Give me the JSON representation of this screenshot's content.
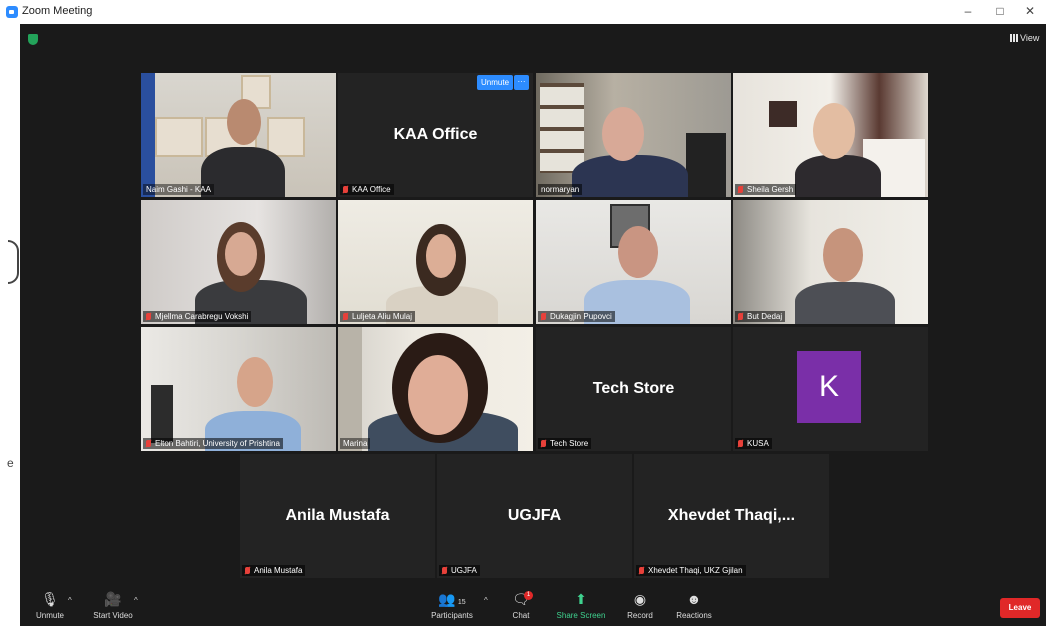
{
  "window": {
    "title": "Zoom Meeting",
    "minimize": "–",
    "restore": "□",
    "close": "✕"
  },
  "top": {
    "view_label": "View"
  },
  "active_tile": {
    "unmute_label": "Unmute",
    "more_label": "···"
  },
  "tiles": [
    {
      "name": "Naim Gashi - KAA",
      "muted": false
    },
    {
      "name": "KAA Office",
      "display": "KAA Office",
      "muted": true
    },
    {
      "name": "normaryan",
      "muted": false
    },
    {
      "name": "Sheila Gersh",
      "muted": true
    },
    {
      "name": "Mjellma Carabregu Vokshi",
      "muted": true
    },
    {
      "name": "Luljeta Aliu Mulaj",
      "muted": true
    },
    {
      "name": "Dukagjin Pupovci",
      "muted": true
    },
    {
      "name": "But Dedaj",
      "muted": true
    },
    {
      "name": "Elton Bahtiri, University of Prishtina",
      "muted": true
    },
    {
      "name": "Marina",
      "muted": false
    },
    {
      "name": "Tech Store",
      "display": "Tech Store",
      "muted": true
    },
    {
      "name": "KUSA",
      "avatar": "K",
      "muted": true
    },
    {
      "name": "Anila Mustafa",
      "display": "Anila Mustafa",
      "muted": true
    },
    {
      "name": "UGJFA",
      "display": "UGJFA",
      "muted": true
    },
    {
      "name": "Xhevdet Thaqi, UKZ Gjilan",
      "display": "Xhevdet  Thaqi,...",
      "muted": true
    }
  ],
  "toolbar": {
    "unmute": "Unmute",
    "start_video": "Start Video",
    "participants": "Participants",
    "participants_count": "15",
    "chat": "Chat",
    "chat_badge": "1",
    "share_screen": "Share Screen",
    "record": "Record",
    "reactions": "Reactions",
    "leave": "Leave"
  },
  "colors": {
    "accent": "#2d8cff",
    "active_border": "#c8de4d",
    "leave": "#e02828",
    "share": "#3fd28f",
    "avatar_k": "#7a2fa8"
  }
}
